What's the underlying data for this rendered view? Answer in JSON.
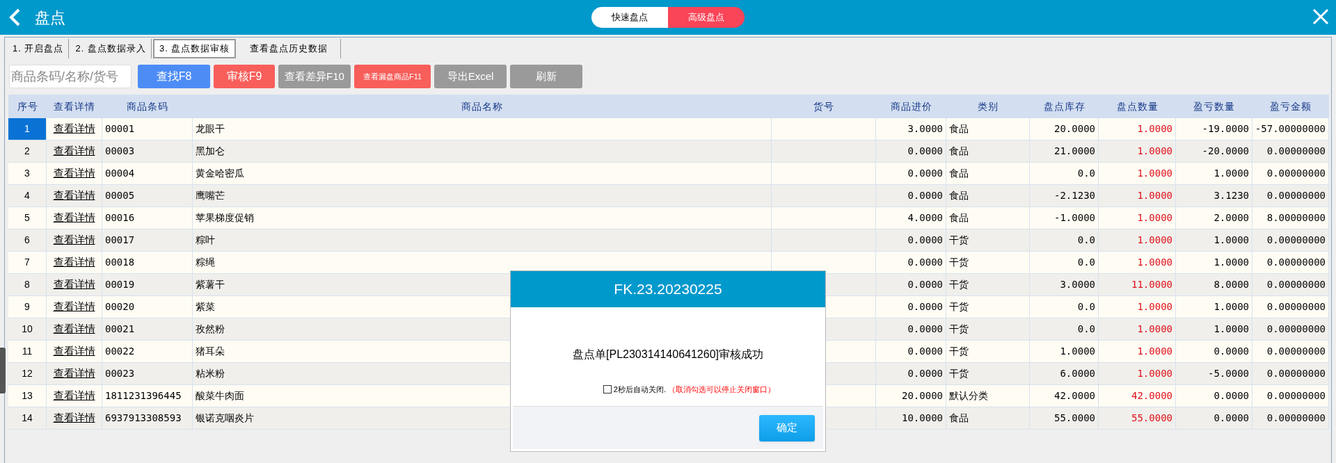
{
  "header": {
    "title": "盘点",
    "modes": [
      {
        "label": "快速盘点",
        "selected": false
      },
      {
        "label": "高级盘点",
        "selected": true
      }
    ]
  },
  "tabs": [
    {
      "label": "1. 开启盘点",
      "selected": false
    },
    {
      "label": "2. 盘点数据录入",
      "selected": false
    },
    {
      "label": "3. 盘点数据审核",
      "selected": true
    },
    {
      "label": "查看盘点历史数据",
      "selected": false
    }
  ],
  "search": {
    "placeholder": "商品条码/名称/货号"
  },
  "buttons": [
    {
      "label": "查找F8",
      "kind": "blue"
    },
    {
      "label": "审核F9",
      "kind": "red"
    },
    {
      "label": "查看差异F10",
      "kind": "gray"
    },
    {
      "label": "查看漏盘商品F11",
      "kind": "redsmall"
    },
    {
      "label": "导出Excel",
      "kind": "gray"
    },
    {
      "label": "刷新",
      "kind": "gray"
    }
  ],
  "table": {
    "columns": [
      "序号",
      "查看详情",
      "商品条码",
      "商品名称",
      "货号",
      "商品进价",
      "类别",
      "盘点库存",
      "盘点数量",
      "盈亏数量",
      "盈亏金额"
    ],
    "rows": [
      {
        "selected": true,
        "cells": [
          "1",
          "查看详情",
          "00001",
          "龙眼干",
          "",
          "3.0000",
          "食品",
          "20.0000",
          "1.0000",
          "-19.0000",
          "-57.00000000"
        ]
      },
      {
        "selected": false,
        "cells": [
          "2",
          "查看详情",
          "00003",
          "黑加仑",
          "",
          "0.0000",
          "食品",
          "21.0000",
          "1.0000",
          "-20.0000",
          "0.00000000"
        ]
      },
      {
        "selected": false,
        "cells": [
          "3",
          "查看详情",
          "00004",
          "黄金哈密瓜",
          "",
          "0.0000",
          "食品",
          "0.0",
          "1.0000",
          "1.0000",
          "0.00000000"
        ]
      },
      {
        "selected": false,
        "cells": [
          "4",
          "查看详情",
          "00005",
          "鹰嘴芒",
          "",
          "0.0000",
          "食品",
          "-2.1230",
          "1.0000",
          "3.1230",
          "0.00000000"
        ]
      },
      {
        "selected": false,
        "cells": [
          "5",
          "查看详情",
          "00016",
          "苹果梯度促销",
          "",
          "4.0000",
          "食品",
          "-1.0000",
          "1.0000",
          "2.0000",
          "8.00000000"
        ]
      },
      {
        "selected": false,
        "cells": [
          "6",
          "查看详情",
          "00017",
          "粽叶",
          "",
          "0.0000",
          "干货",
          "0.0",
          "1.0000",
          "1.0000",
          "0.00000000"
        ]
      },
      {
        "selected": false,
        "cells": [
          "7",
          "查看详情",
          "00018",
          "粽绳",
          "",
          "0.0000",
          "干货",
          "0.0",
          "1.0000",
          "1.0000",
          "0.00000000"
        ]
      },
      {
        "selected": false,
        "cells": [
          "8",
          "查看详情",
          "00019",
          "紫薯干",
          "",
          "0.0000",
          "干货",
          "3.0000",
          "11.0000",
          "8.0000",
          "0.00000000"
        ]
      },
      {
        "selected": false,
        "cells": [
          "9",
          "查看详情",
          "00020",
          "紫菜",
          "",
          "0.0000",
          "干货",
          "0.0",
          "1.0000",
          "1.0000",
          "0.00000000"
        ]
      },
      {
        "selected": false,
        "cells": [
          "10",
          "查看详情",
          "00021",
          "孜然粉",
          "",
          "0.0000",
          "干货",
          "0.0",
          "1.0000",
          "1.0000",
          "0.00000000"
        ]
      },
      {
        "selected": false,
        "cells": [
          "11",
          "查看详情",
          "00022",
          "猪耳朵",
          "",
          "0.0000",
          "干货",
          "1.0000",
          "1.0000",
          "0.0000",
          "0.00000000"
        ]
      },
      {
        "selected": false,
        "cells": [
          "12",
          "查看详情",
          "00023",
          "粘米粉",
          "",
          "0.0000",
          "干货",
          "6.0000",
          "1.0000",
          "-5.0000",
          "0.00000000"
        ]
      },
      {
        "selected": false,
        "cells": [
          "13",
          "查看详情",
          "1811231396445",
          "酸菜牛肉面",
          "",
          "20.0000",
          "默认分类",
          "42.0000",
          "42.0000",
          "0.0000",
          "0.00000000"
        ]
      },
      {
        "selected": false,
        "cells": [
          "14",
          "查看详情",
          "6937913308593",
          "银诺克咽炎片",
          "",
          "10.0000",
          "食品",
          "55.0000",
          "55.0000",
          "0.0000",
          "0.00000000"
        ]
      }
    ]
  },
  "dialog": {
    "title": "FK.23.20230225",
    "message": "盘点单[PL230314140641260]审核成功",
    "auto_close": {
      "label": "2秒后自动关闭.",
      "note": "（取消勾选可以停止关闭窗口）",
      "checked": false
    },
    "ok": "确定"
  }
}
